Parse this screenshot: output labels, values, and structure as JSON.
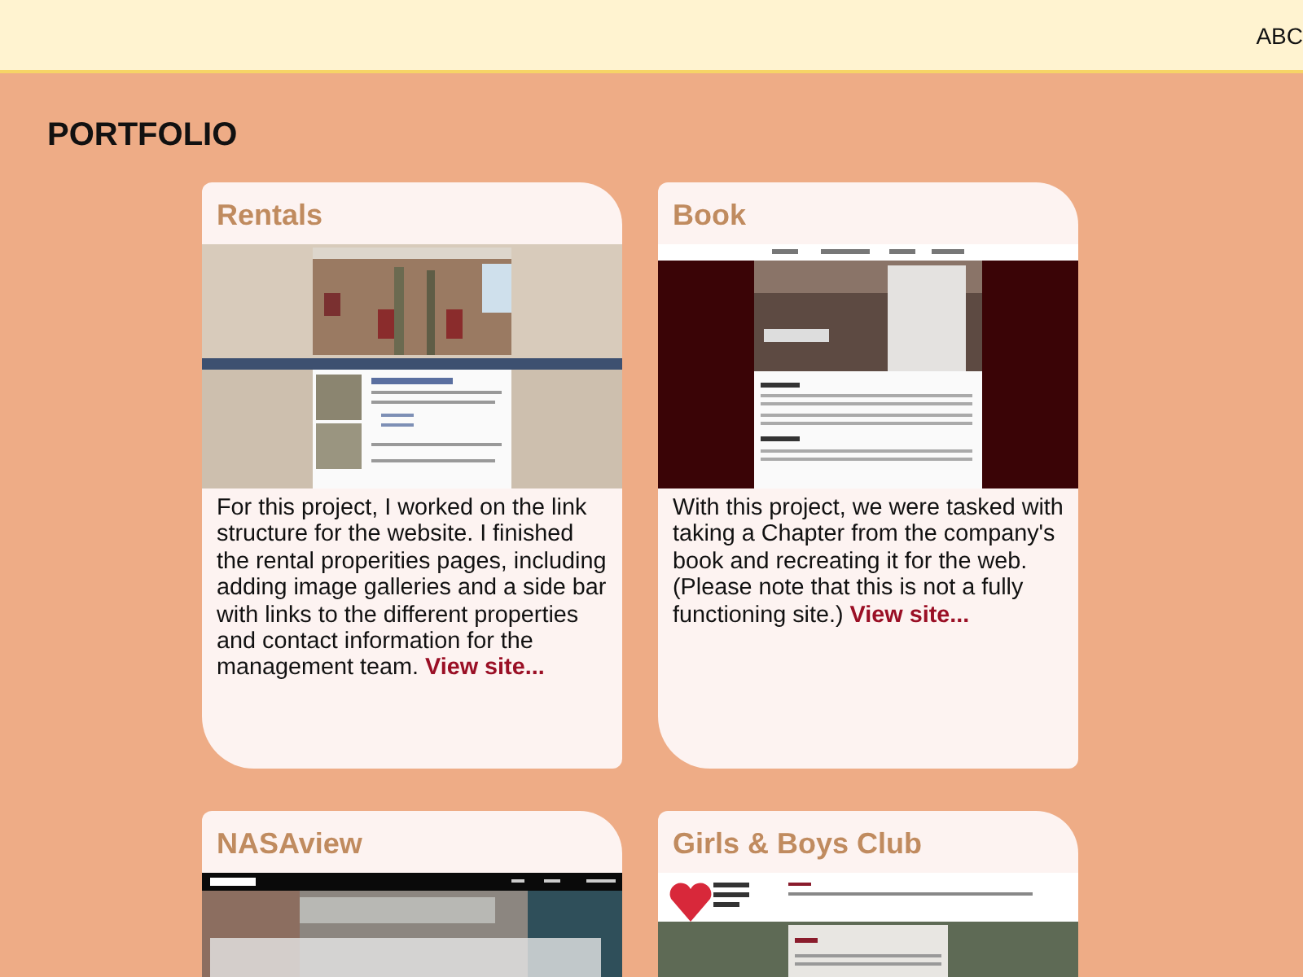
{
  "header": {
    "nav_items": [
      "ABC"
    ]
  },
  "page_title": "PORTFOLIO",
  "projects": [
    {
      "title": "Rentals",
      "kind": "rentals",
      "description": "For this project, I worked on the link structure for the website. I finished the rental properities pages, including adding image galleries and a side bar with links to the different properties and contact information for the management team.",
      "link_text": "View site..."
    },
    {
      "title": "Book",
      "kind": "book",
      "description": "With this project, we were tasked with taking a Chapter from the company's book and recreating it for the web. (Please note that this is not a fully functioning site.)",
      "link_text": "View site..."
    },
    {
      "title": "NASAview",
      "kind": "nasa"
    },
    {
      "title": "Girls & Boys Club",
      "kind": "club"
    }
  ]
}
